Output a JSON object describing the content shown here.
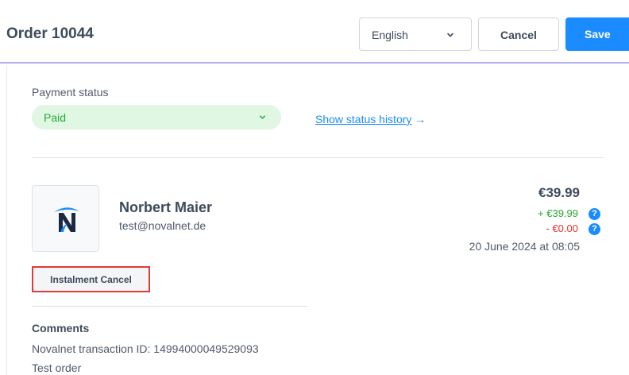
{
  "header": {
    "title": "Order 10044",
    "language": "English",
    "cancel_label": "Cancel",
    "save_label": "Save"
  },
  "payment": {
    "label": "Payment status",
    "status": "Paid",
    "history_link": "Show status history",
    "history_arrow": "→"
  },
  "customer": {
    "name": "Norbert Maier",
    "email": "test@novalnet.de"
  },
  "amounts": {
    "total": "€39.99",
    "paid": "+ €39.99",
    "refunded": "- €0.00",
    "help_glyph": "?",
    "date": "20 June 2024 at 08:05"
  },
  "actions": {
    "instalment_cancel_label": "Instalment Cancel"
  },
  "comments": {
    "title": "Comments",
    "lines": [
      "Novalnet transaction ID: 14994000049529093",
      "Test order"
    ]
  },
  "colors": {
    "accent": "#1a8cff",
    "paid_green": "#26a834",
    "refund_red": "#e2312c",
    "highlight_border": "#e03a3a",
    "header_underline": "#b7b0f0"
  },
  "icons": {
    "language_dropdown": "chevron-down-icon",
    "status_dropdown": "chevron-down-icon",
    "help": "question-circle-icon",
    "logo": "novalnet-logo"
  }
}
